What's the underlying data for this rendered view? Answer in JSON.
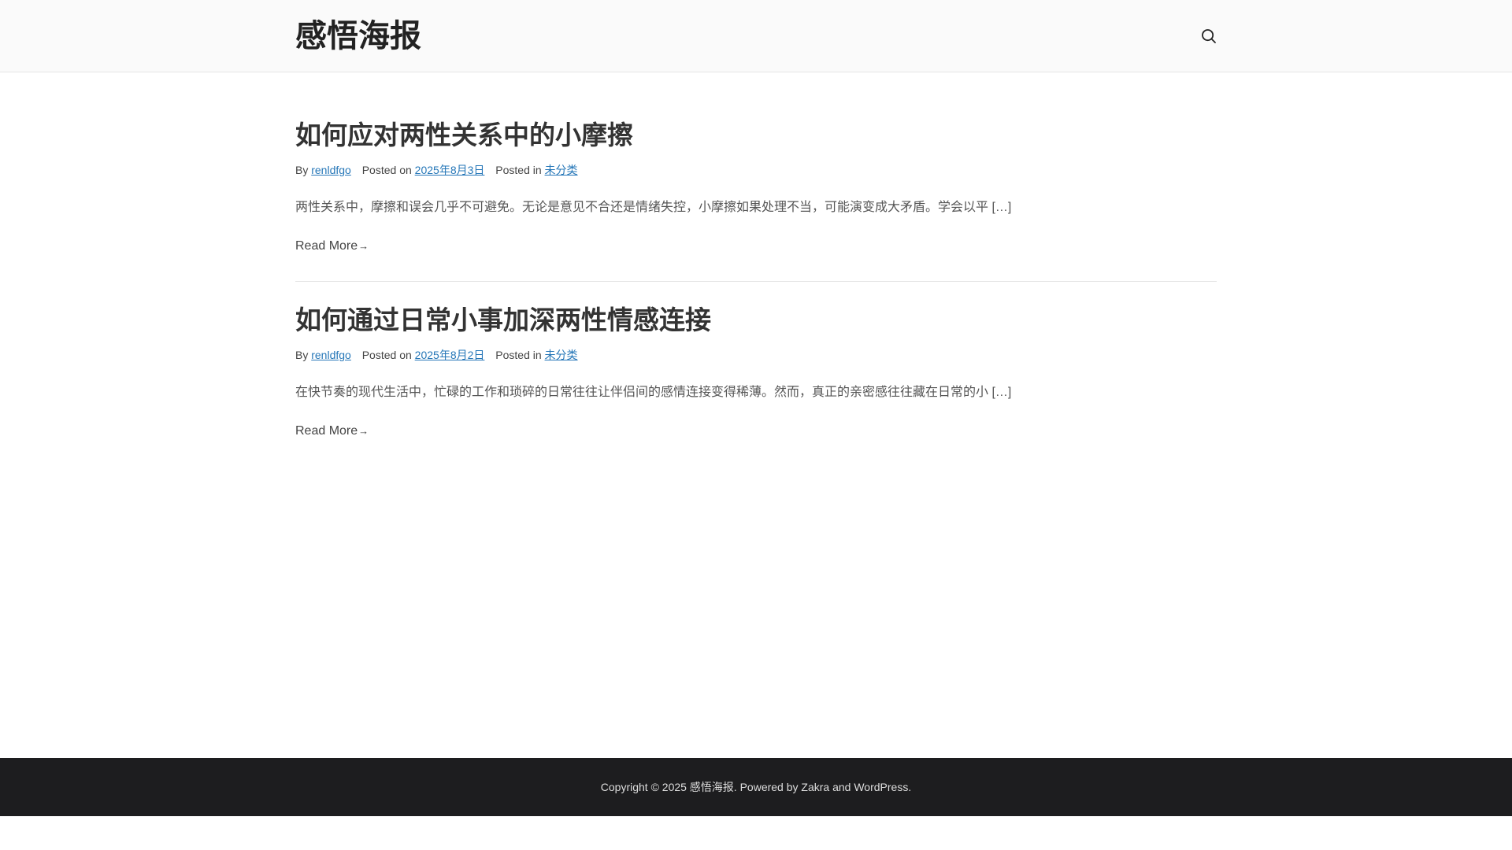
{
  "header": {
    "site_title": "感悟海报",
    "search_icon": "search-icon"
  },
  "posts": [
    {
      "title": "如何应对两性关系中的小摩擦",
      "by_label": "By",
      "author": "renldfgo",
      "posted_on_label": "Posted on",
      "date": "2025年8月3日",
      "posted_in_label": "Posted in",
      "category": "未分类",
      "excerpt": "两性关系中，摩擦和误会几乎不可避免。无论是意见不合还是情绪失控，小摩擦如果处理不当，可能演变成大矛盾。学会以平 […]",
      "read_more": "Read More",
      "read_more_arrow": "→"
    },
    {
      "title": "如何通过日常小事加深两性情感连接",
      "by_label": "By",
      "author": "renldfgo",
      "posted_on_label": "Posted on",
      "date": "2025年8月2日",
      "posted_in_label": "Posted in",
      "category": "未分类",
      "excerpt": "在快节奏的现代生活中，忙碌的工作和琐碎的日常往往让伴侣间的感情连接变得稀薄。然而，真正的亲密感往往藏在日常的小 […]",
      "read_more": "Read More",
      "read_more_arrow": "→"
    }
  ],
  "footer": {
    "copyright": "Copyright © 2025 感悟海报. Powered by Zakra and WordPress."
  },
  "colors": {
    "link": "#2677b8",
    "footer_bg": "#1d1d1f",
    "header_bg": "#fafafa"
  }
}
